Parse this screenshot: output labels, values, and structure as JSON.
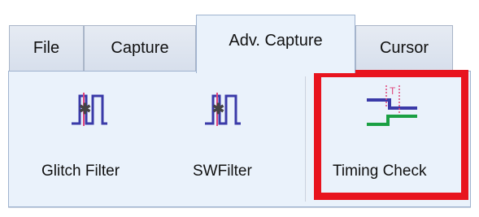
{
  "tabs": [
    {
      "label": "File"
    },
    {
      "label": "Capture"
    },
    {
      "label": "Adv. Capture"
    },
    {
      "label": "Cursor"
    }
  ],
  "active_tab": "Adv. Capture",
  "buttons": [
    {
      "label": "Glitch Filter",
      "icon": "glitch-filter-icon"
    },
    {
      "label": "SWFilter",
      "icon": "swfilter-icon"
    },
    {
      "label": "Timing Check",
      "icon": "timing-check-icon"
    }
  ],
  "highlight_color": "#e8141e",
  "icon_colors": {
    "signal": "#3a3aa8",
    "marker": "#e0457b",
    "green": "#1aa043"
  },
  "timing_icon_text": "T"
}
